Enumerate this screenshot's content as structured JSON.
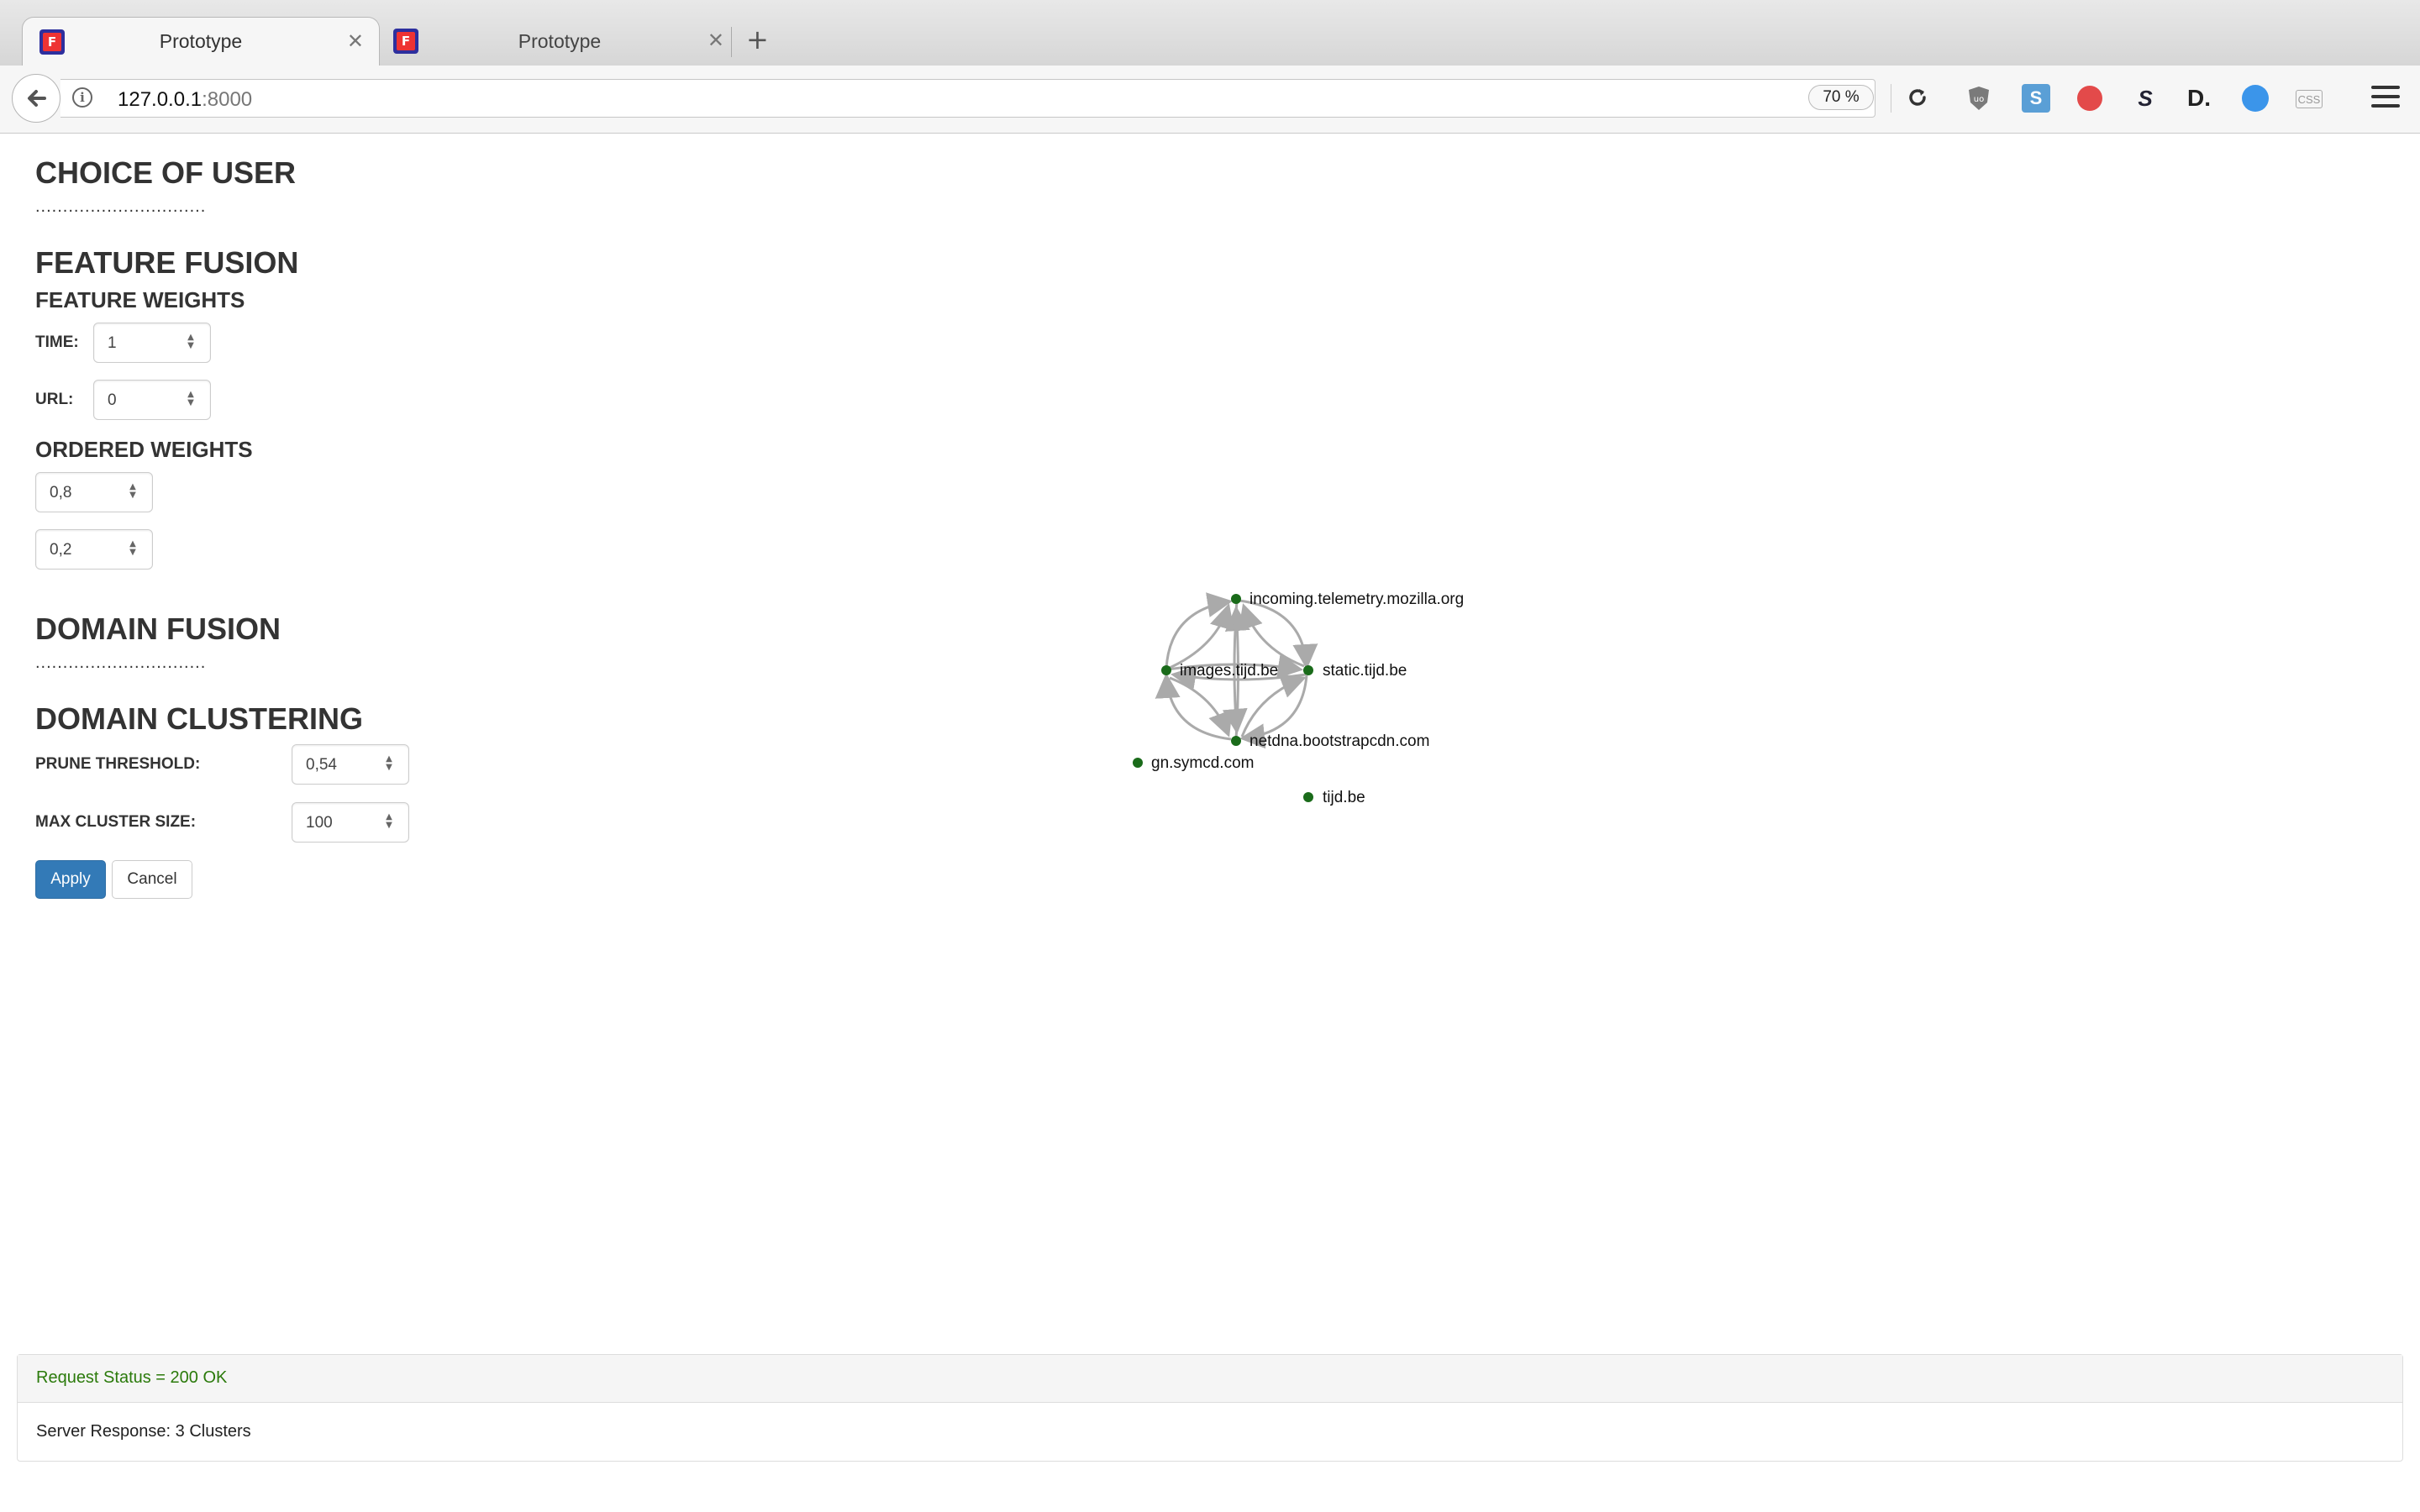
{
  "browser": {
    "tabs": [
      {
        "title": "Prototype",
        "active": true
      },
      {
        "title": "Prototype",
        "active": false
      }
    ],
    "new_tab_icon": "plus-icon",
    "url_host": "127.0.0.1",
    "url_port": ":8000",
    "zoom": "70 %",
    "extensions": [
      "ublock-icon",
      "s-extension-icon",
      "red-extension-icon",
      "sj-extension-icon",
      "d-extension-icon",
      "profile-icon",
      "css-extension-icon"
    ]
  },
  "sections": {
    "choice_of_user": {
      "title": "CHOICE OF USER",
      "placeholder": "..............................."
    },
    "feature_fusion": {
      "title": "FEATURE FUSION",
      "weights_title": "FEATURE WEIGHTS",
      "time_label": "TIME:",
      "time_value": "1",
      "url_label": "URL:",
      "url_value": "0",
      "ordered_title": "ORDERED WEIGHTS",
      "ordered_values": [
        "0,8",
        "0,2"
      ]
    },
    "domain_fusion": {
      "title": "DOMAIN FUSION",
      "placeholder": "..............................."
    },
    "domain_clustering": {
      "title": "DOMAIN CLUSTERING",
      "prune_label": "PRUNE THRESHOLD:",
      "prune_value": "0,54",
      "max_label": "MAX CLUSTER SIZE:",
      "max_value": "100"
    }
  },
  "buttons": {
    "apply": "Apply",
    "cancel": "Cancel"
  },
  "graph": {
    "nodes": [
      "incoming.telemetry.mozilla.org",
      "images.tijd.be",
      "static.tijd.be",
      "netdna.bootstrapcdn.com",
      "gn.symcd.com",
      "tijd.be"
    ],
    "node_color": "#1a6b1a",
    "edge_color": "#aaaaaa"
  },
  "status": {
    "request_status": "Request Status = 200 OK",
    "server_response": "Server Response: 3 Clusters",
    "ok_color": "#2b7a0b"
  }
}
